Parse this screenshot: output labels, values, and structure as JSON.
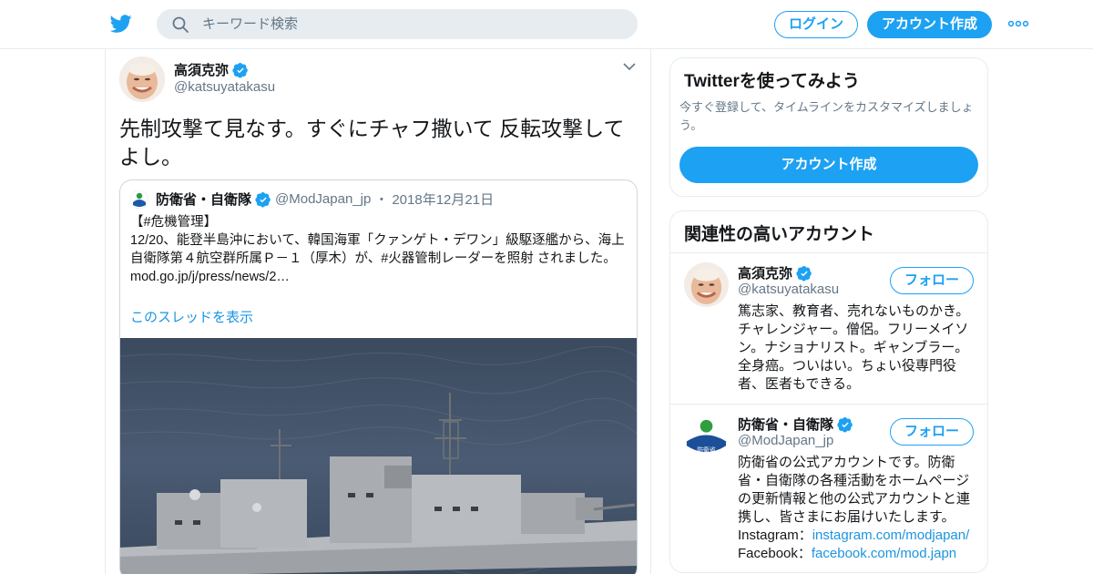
{
  "header": {
    "search_placeholder": "キーワード検索",
    "login_label": "ログイン",
    "signup_label": "アカウント作成",
    "logo_icon": "twitter-bird-icon",
    "more_icon": "more-dots-icon"
  },
  "tweet": {
    "author_name": "高須克弥",
    "author_handle": "@katsuyatakasu",
    "text": "先制攻撃て見なす。すぐにチャフ撒いて 反転攻撃してよし。",
    "quote": {
      "name": "防衛省・自衛隊",
      "handle": "@ModJapan_jp",
      "sep": "・",
      "date": "2018年12月21日",
      "body_line1": "【#危機管理】",
      "body_line2": " 12/20、能登半島沖において、韓国海軍「クァンゲト・デワン」級駆逐艦から、海上自衛隊第４航空群所属Ｐ－１（厚木）が、#火器管制レーダーを照射 されました。",
      "body_line3": "mod.go.jp/j/press/news/2…",
      "thread_link": "このスレッドを表示"
    }
  },
  "sidebar": {
    "signup_card": {
      "title": "Twitterを使ってみよう",
      "subtitle": "今すぐ登録して、タイムラインをカスタマイズしましょう。",
      "button": "アカウント作成"
    },
    "related": {
      "title": "関連性の高いアカウント",
      "accounts": [
        {
          "name": "高須克弥",
          "handle": "@katsuyatakasu",
          "follow": "フォロー",
          "bio": "篤志家、教育者、売れないものかき。チャレンジャー。僧侶。フリーメイソン。ナショナリスト。ギャンブラー。全身癌。ついはい。ちょい役専門役者、医者もできる。"
        },
        {
          "name": "防衛省・自衛隊",
          "handle": "@ModJapan_jp",
          "follow": "フォロー",
          "bio": "防衛省の公式アカウントです。防衛省・自衛隊の各種活動をホームページの更新情報と他の公式アカウントと連携し、皆さまにお届けいたします。",
          "instagram_label": "Instagram：",
          "instagram_link": "instagram.com/modjapan/",
          "facebook_label": "Facebook：",
          "facebook_link": "facebook.com/mod.japn"
        }
      ]
    }
  },
  "colors": {
    "accent": "#1da1f2",
    "link": "#1b95e0",
    "muted": "#657786",
    "border": "#e6ecf0"
  }
}
